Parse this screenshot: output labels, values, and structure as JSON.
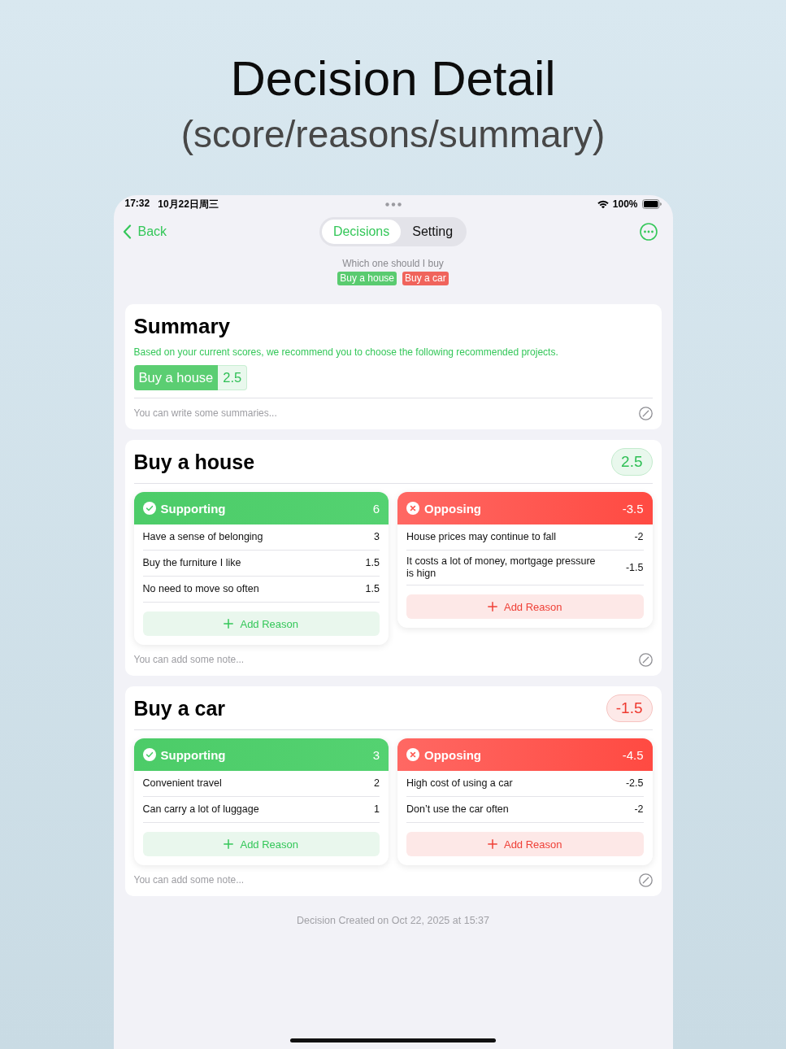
{
  "heading": {
    "title": "Decision Detail",
    "subtitle": "(score/reasons/summary)"
  },
  "status_bar": {
    "time": "17:32",
    "date": "10月22日周三",
    "battery": "100%"
  },
  "nav": {
    "back": "Back",
    "tabs": [
      {
        "label": "Decisions",
        "selected": true
      },
      {
        "label": "Setting",
        "selected": false
      }
    ]
  },
  "decision": {
    "question": "Which one should I buy",
    "options": [
      {
        "label": "Buy a house",
        "color": "#5acb70"
      },
      {
        "label": "Buy a car",
        "color": "#f0645c"
      }
    ]
  },
  "summary": {
    "title": "Summary",
    "text": "Based on your current scores, we recommend you to choose the following recommended projects.",
    "recommendation": {
      "label": "Buy a house",
      "score": "2.5"
    },
    "placeholder": "You can write some summaries..."
  },
  "options": [
    {
      "title": "Buy a house",
      "score": "2.5",
      "kind": "positive",
      "columns": [
        {
          "kind": "supporting",
          "label": "Supporting",
          "total": "6",
          "reasons": [
            {
              "text": "Have a sense of belonging",
              "score": "3"
            },
            {
              "text": "Buy the furniture I like",
              "score": "1.5"
            },
            {
              "text": "No need to move so often",
              "score": "1.5"
            }
          ],
          "add_label": "Add Reason"
        },
        {
          "kind": "opposing",
          "label": "Opposing",
          "total": "-3.5",
          "reasons": [
            {
              "text": "House prices may continue to fall",
              "score": "-2"
            },
            {
              "text": "It costs a lot of money, mortgage pressure is hign",
              "score": "-1.5"
            }
          ],
          "add_label": "Add Reason"
        }
      ],
      "placeholder": "You can add some note..."
    },
    {
      "title": "Buy a car",
      "score": "-1.5",
      "kind": "negative",
      "columns": [
        {
          "kind": "supporting",
          "label": "Supporting",
          "total": "3",
          "reasons": [
            {
              "text": "Convenient travel",
              "score": "2"
            },
            {
              "text": "Can carry a lot of luggage",
              "score": "1"
            }
          ],
          "add_label": "Add Reason"
        },
        {
          "kind": "opposing",
          "label": "Opposing",
          "total": "-4.5",
          "reasons": [
            {
              "text": "High cost of using a car",
              "score": "-2.5"
            },
            {
              "text": "Don’t use the car often",
              "score": "-2"
            }
          ],
          "add_label": "Add Reason"
        }
      ],
      "placeholder": "You can add some note..."
    }
  ],
  "footer": "Decision Created on Oct 22, 2025 at 15:37"
}
